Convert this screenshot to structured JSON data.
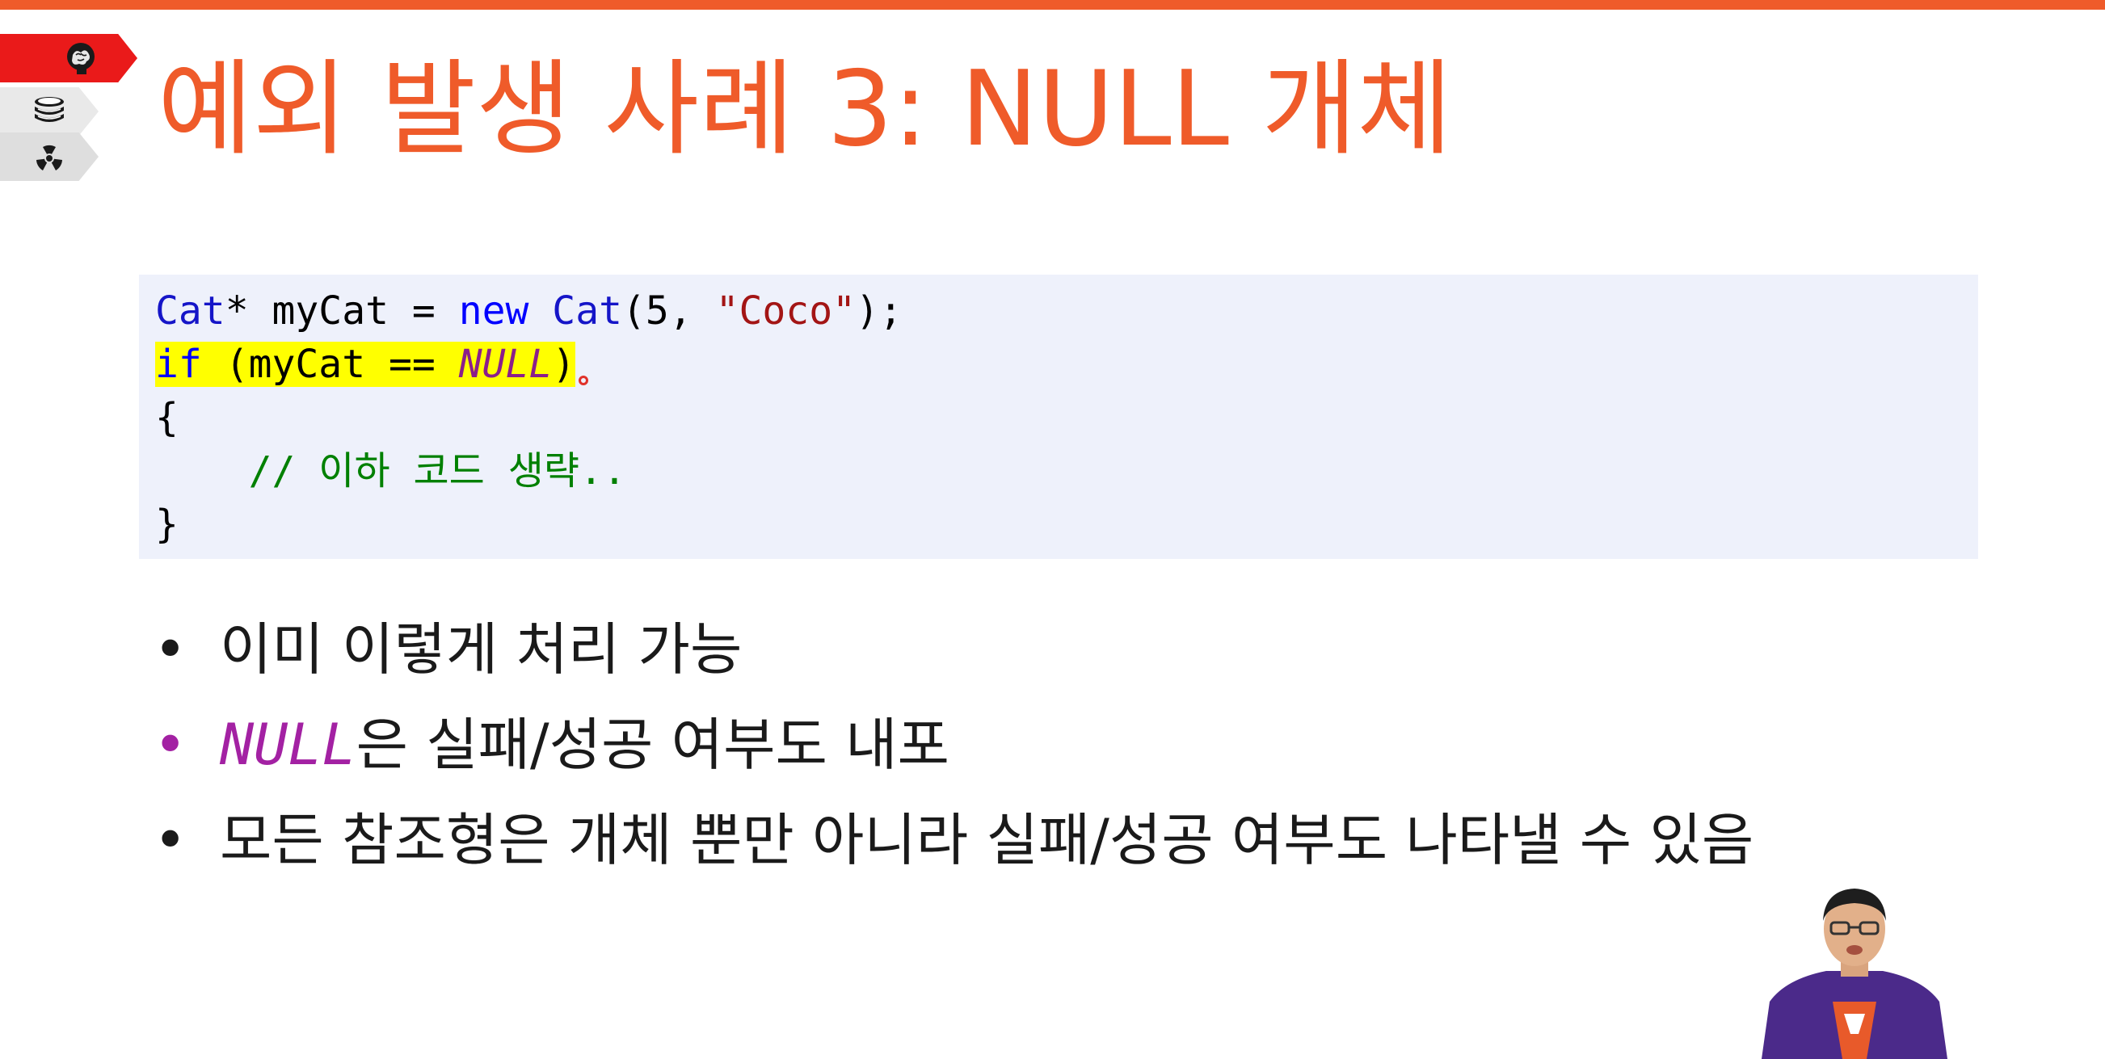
{
  "slide": {
    "title": "예외 발생 사례 3: NULL 개체",
    "code": {
      "line1": {
        "type1": "Cat",
        "rest1": "* myCat = ",
        "kw_new": "new",
        "space": " ",
        "type2": "Cat",
        "args_open": "(5, ",
        "string": "\"Coco\"",
        "args_close": ");"
      },
      "line2": {
        "kw_if": "if",
        "mid": " (myCat == ",
        "macro": "NULL",
        "close": ")"
      },
      "line3": "{",
      "line4": {
        "indent": "    ",
        "comment": "// 이하 코드 생략.."
      },
      "line5": "}"
    },
    "bullets": [
      {
        "marker": "•",
        "text": "이미 이렇게 처리 가능"
      },
      {
        "marker": "•",
        "prefix": "NULL",
        "text": "은 실패/성공 여부도 내포"
      },
      {
        "marker": "•",
        "text": "모든 참조형은 개체 뿐만 아니라 실패/성공 여부도 나타낼 수 있음"
      }
    ]
  },
  "nav": {
    "tabs": [
      {
        "icon": "brain-icon",
        "active": true
      },
      {
        "icon": "books-icon",
        "active": false
      },
      {
        "icon": "radiation-icon",
        "active": false
      }
    ]
  },
  "colors": {
    "accent": "#ef5b2a",
    "code_bg": "#eef1fb",
    "highlight": "#ffff00",
    "macro": "#a321a3"
  }
}
